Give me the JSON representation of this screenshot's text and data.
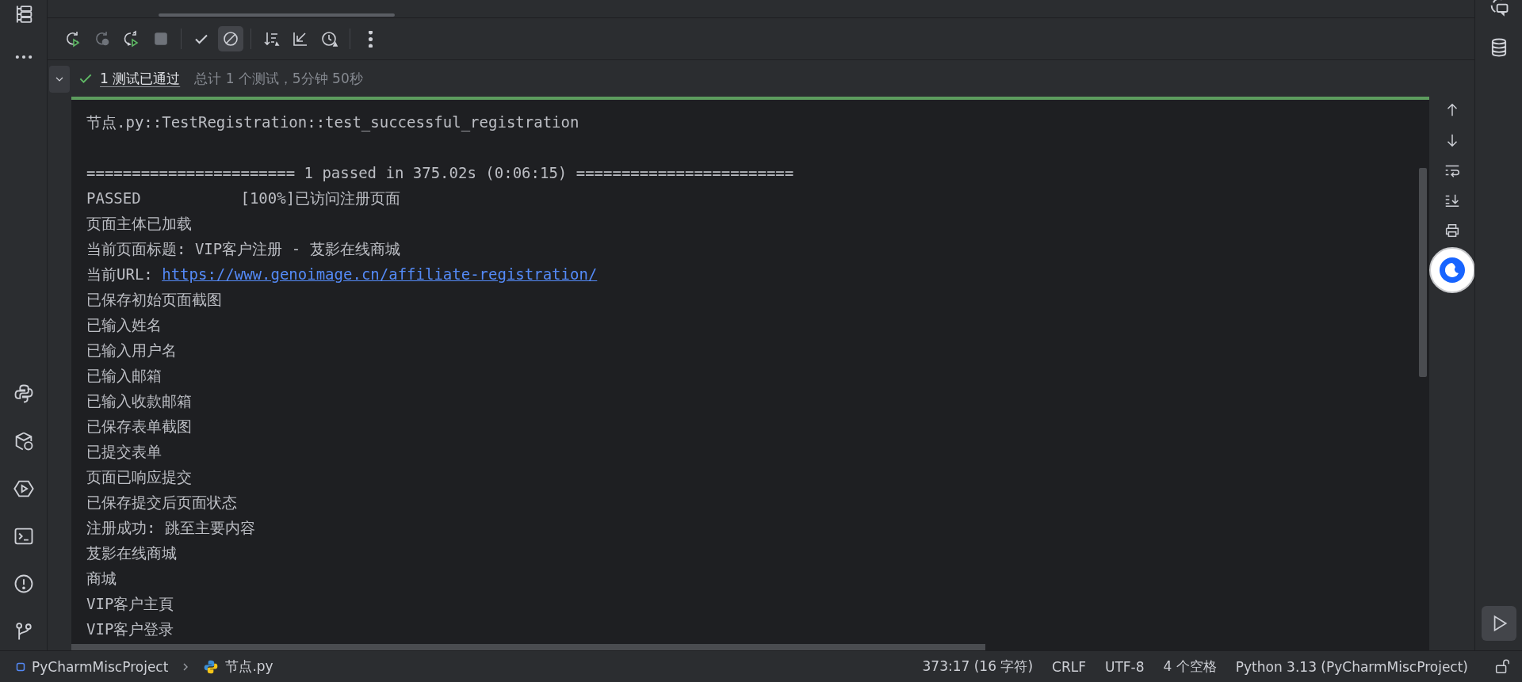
{
  "toolbar": [
    {
      "kind": "rerun",
      "selected": false,
      "disabled": false
    },
    {
      "kind": "rerun-failed",
      "selected": false,
      "disabled": true
    },
    {
      "kind": "auto-rerun",
      "selected": false,
      "disabled": false
    },
    {
      "kind": "stop",
      "selected": false,
      "disabled": true
    },
    {
      "kind": "separator"
    },
    {
      "kind": "show-passed",
      "selected": false,
      "disabled": false
    },
    {
      "kind": "show-ignored",
      "selected": true,
      "disabled": false
    },
    {
      "kind": "separator"
    },
    {
      "kind": "sort",
      "selected": false,
      "disabled": false
    },
    {
      "kind": "import",
      "selected": false,
      "disabled": false
    },
    {
      "kind": "history",
      "selected": false,
      "disabled": false
    },
    {
      "kind": "separator"
    },
    {
      "kind": "more",
      "selected": false,
      "disabled": false
    }
  ],
  "summary": {
    "status": "1 测试已通过",
    "detail": "总计 1 个测试，5分钟 50秒",
    "passed": true
  },
  "output": [
    {
      "kind": "text",
      "text": "节点.py::TestRegistration::test_successful_registration"
    },
    {
      "kind": "blank"
    },
    {
      "kind": "text",
      "text": "======================= 1 passed in 375.02s (0:06:15) ========================"
    },
    {
      "kind": "text",
      "text": "PASSED           [100%]已访问注册页面"
    },
    {
      "kind": "text",
      "text": "页面主体已加载"
    },
    {
      "kind": "text",
      "text": "当前页面标题: VIP客户注册 - 芨影在线商城"
    },
    {
      "kind": "link",
      "prefix": "当前URL:",
      "url": "https://www.genoimage.cn/affiliate-registration/"
    },
    {
      "kind": "text",
      "text": "已保存初始页面截图"
    },
    {
      "kind": "text",
      "text": "已输入姓名"
    },
    {
      "kind": "text",
      "text": "已输入用户名"
    },
    {
      "kind": "text",
      "text": "已输入邮箱"
    },
    {
      "kind": "text",
      "text": "已输入收款邮箱"
    },
    {
      "kind": "text",
      "text": "已保存表单截图"
    },
    {
      "kind": "text",
      "text": "已提交表单"
    },
    {
      "kind": "text",
      "text": "页面已响应提交"
    },
    {
      "kind": "text",
      "text": "已保存提交后页面状态"
    },
    {
      "kind": "text",
      "text": "注册成功: 跳至主要内容"
    },
    {
      "kind": "text",
      "text": "芨影在线商城"
    },
    {
      "kind": "text",
      "text": "商城"
    },
    {
      "kind": "text",
      "text": "VIP客户主頁"
    },
    {
      "kind": "text",
      "text": "VIP客户登录"
    }
  ],
  "status_bar": {
    "project": "PyCharmMiscProject",
    "file": "节点.py",
    "position": "373:17 (16 字符)",
    "line_ending": "CRLF",
    "encoding": "UTF-8",
    "indent": "4 个空格",
    "interpreter": "Python 3.13 (PyCharmMiscProject)"
  }
}
